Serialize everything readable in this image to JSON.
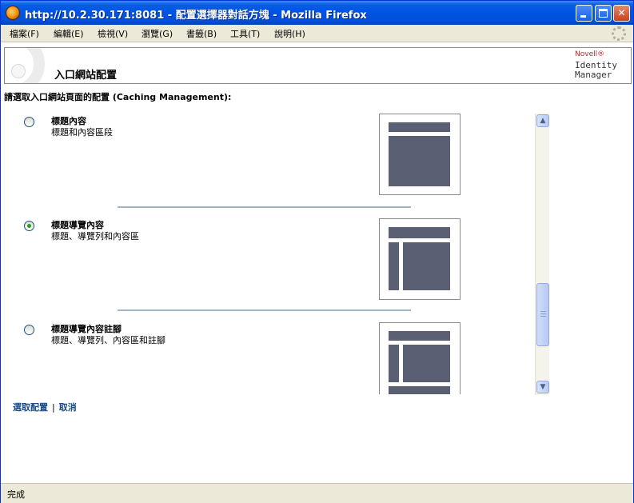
{
  "window": {
    "title": "http://10.2.30.171:8081 - 配置選擇器對話方塊 - Mozilla Firefox"
  },
  "menubar": {
    "items": [
      "檔案(F)",
      "編輯(E)",
      "檢視(V)",
      "瀏覽(G)",
      "書籤(B)",
      "工具(T)",
      "說明(H)"
    ]
  },
  "header": {
    "title": "入口網站配置",
    "brand": "Novell®",
    "product_line1": "Identity",
    "product_line2": "Manager"
  },
  "prompt": "請選取入口網站頁面的配置 (Caching Management):",
  "options": [
    {
      "title": "標題內容",
      "description": "標題和內容區段",
      "selected": false
    },
    {
      "title": "標題導覽內容",
      "description": "標題、導覽列和內容區",
      "selected": true
    },
    {
      "title": "標題導覽內容註腳",
      "description": "標題、導覽列、內容區和註腳",
      "selected": false
    }
  ],
  "scrollbar": {
    "position_fraction": 0.82
  },
  "links": {
    "select": "選取配置",
    "separator": "|",
    "cancel": "取消"
  },
  "status": {
    "text": "完成"
  },
  "colors": {
    "titlebar": "#0055e5",
    "layout_block": "#5b5f73",
    "separator": "#9fb6c6",
    "link": "#1a4a8a",
    "radio_dot": "#21a121"
  }
}
